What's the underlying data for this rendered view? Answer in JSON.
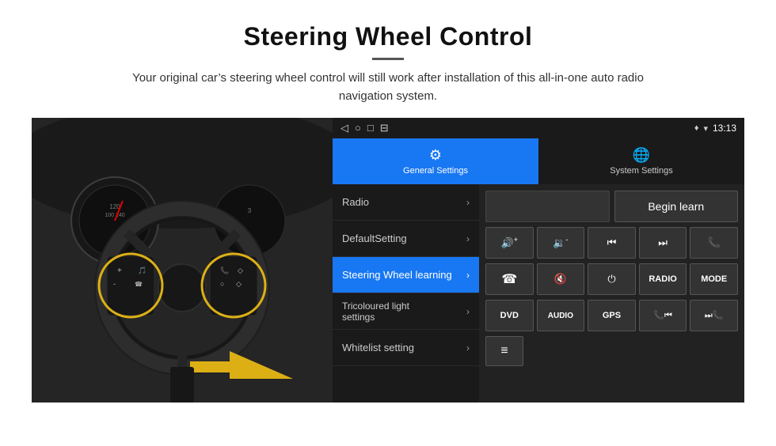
{
  "header": {
    "title": "Steering Wheel Control",
    "subtitle": "Your original car’s steering wheel control will still work after installation of this all-in-one auto radio navigation system."
  },
  "statusBar": {
    "time": "13:13",
    "icons": [
      "◁",
      "○",
      "□",
      "⊟"
    ]
  },
  "tabs": [
    {
      "id": "general",
      "label": "General Settings",
      "icon": "⚙",
      "active": true
    },
    {
      "id": "system",
      "label": "System Settings",
      "icon": "🌐",
      "active": false
    }
  ],
  "menu": [
    {
      "id": "radio",
      "label": "Radio",
      "active": false
    },
    {
      "id": "default",
      "label": "DefaultSetting",
      "active": false
    },
    {
      "id": "steering",
      "label": "Steering Wheel learning",
      "active": true
    },
    {
      "id": "tricolour",
      "label": "Tricoloured light settings",
      "active": false
    },
    {
      "id": "whitelist",
      "label": "Whitelist setting",
      "active": false
    }
  ],
  "controls": {
    "beginLearnLabel": "Begin learn",
    "row1": [
      {
        "id": "vol-up",
        "symbol": "🔊+"
      },
      {
        "id": "vol-down",
        "symbol": "🔉-"
      },
      {
        "id": "prev-track",
        "symbol": "⏮"
      },
      {
        "id": "next-track",
        "symbol": "⏭"
      },
      {
        "id": "phone",
        "symbol": "📞"
      }
    ],
    "row2": [
      {
        "id": "hang-up",
        "symbol": "📵"
      },
      {
        "id": "mute",
        "symbol": "🔇"
      },
      {
        "id": "power",
        "symbol": "⏻"
      },
      {
        "id": "radio-btn",
        "label": "RADIO"
      },
      {
        "id": "mode-btn",
        "label": "MODE"
      }
    ],
    "row3": [
      {
        "id": "dvd-btn",
        "label": "DVD"
      },
      {
        "id": "audio-btn",
        "label": "AUDIO"
      },
      {
        "id": "gps-btn",
        "label": "GPS"
      },
      {
        "id": "phone2",
        "symbol": "📞⏮"
      },
      {
        "id": "skip",
        "symbol": "⏭📞"
      }
    ],
    "row4": [
      {
        "id": "menu-btn",
        "symbol": "≡"
      }
    ]
  }
}
